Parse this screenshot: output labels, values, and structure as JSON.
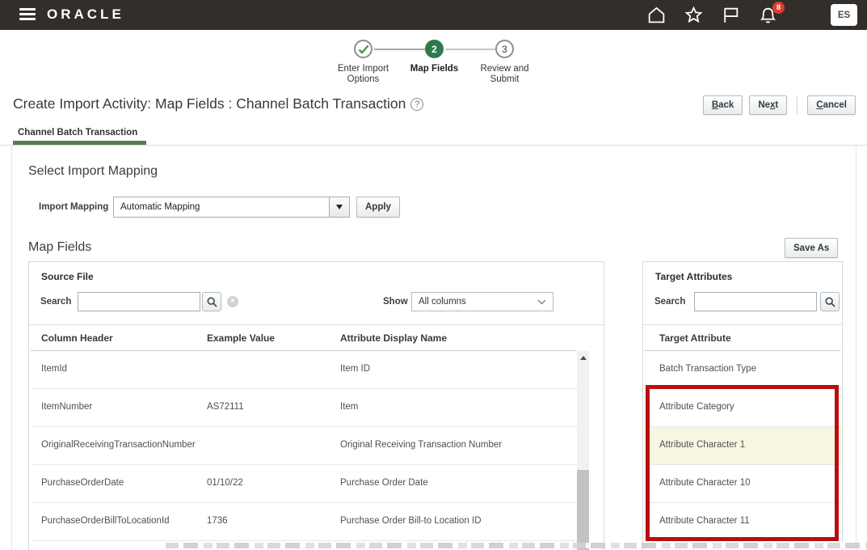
{
  "topbar": {
    "brand": "ORACLE",
    "notification_count": "8",
    "avatar_initials": "ES",
    "icons": [
      "hamburger-menu-icon",
      "home-icon",
      "favorites-star-icon",
      "flag-icon",
      "notifications-bell-icon"
    ]
  },
  "stepper": {
    "steps": [
      {
        "label": "Enter Import Options",
        "state": "complete"
      },
      {
        "label": "Map Fields",
        "number": "2",
        "state": "current"
      },
      {
        "label": "Review and Submit",
        "number": "3",
        "state": "upcoming"
      }
    ]
  },
  "page": {
    "title": "Create Import Activity: Map Fields : Channel Batch Transaction",
    "help_glyph": "?"
  },
  "actions": {
    "back": {
      "key": "B",
      "rest": "ack"
    },
    "next": {
      "pre": "Ne",
      "key": "x",
      "rest": "t"
    },
    "cancel": {
      "key": "C",
      "rest": "ancel"
    },
    "apply": "Apply",
    "save_as": "Save As"
  },
  "tab": {
    "label": "Channel Batch Transaction"
  },
  "import_mapping": {
    "section_title": "Select Import Mapping",
    "label": "Import Mapping",
    "selected_value": "Automatic Mapping"
  },
  "map_fields": {
    "section_title": "Map Fields"
  },
  "source_panel": {
    "title": "Source File",
    "search_label": "Search",
    "show_label": "Show",
    "show_value": "All columns",
    "table": {
      "columns": [
        "Column Header",
        "Example Value",
        "Attribute Display Name"
      ],
      "rows": [
        {
          "column_header": "ItemId",
          "example_value": "",
          "attribute_display_name": "Item ID"
        },
        {
          "column_header": "ItemNumber",
          "example_value": "AS72111",
          "attribute_display_name": "Item"
        },
        {
          "column_header": "OriginalReceivingTransactionNumber",
          "example_value": "",
          "attribute_display_name": "Original Receiving Transaction Number"
        },
        {
          "column_header": "PurchaseOrderDate",
          "example_value": "01/10/22",
          "attribute_display_name": "Purchase Order Date"
        },
        {
          "column_header": "PurchaseOrderBillToLocationId",
          "example_value": "1736",
          "attribute_display_name": "Purchase Order Bill-to Location ID"
        }
      ]
    }
  },
  "target_panel": {
    "title": "Target Attributes",
    "search_label": "Search",
    "column_header": "Target Attribute",
    "rows": [
      "Batch Transaction Type",
      "Attribute Category",
      "Attribute Character 1",
      "Attribute Character 10",
      "Attribute Character 11"
    ],
    "highlighted_row": "Attribute Character 1",
    "annotation": "red-highlight-box around Attribute Category through Attribute Character 11"
  },
  "colors": {
    "topbar_bg": "#332e2a",
    "step_green": "#2c7b4f",
    "check_green": "#3f9c3f",
    "tab_underline_green": "#5c7a4e",
    "badge_red": "#de3d2e",
    "row_highlight": "#f7f7e1",
    "annotation_red": "#b80f0e"
  }
}
